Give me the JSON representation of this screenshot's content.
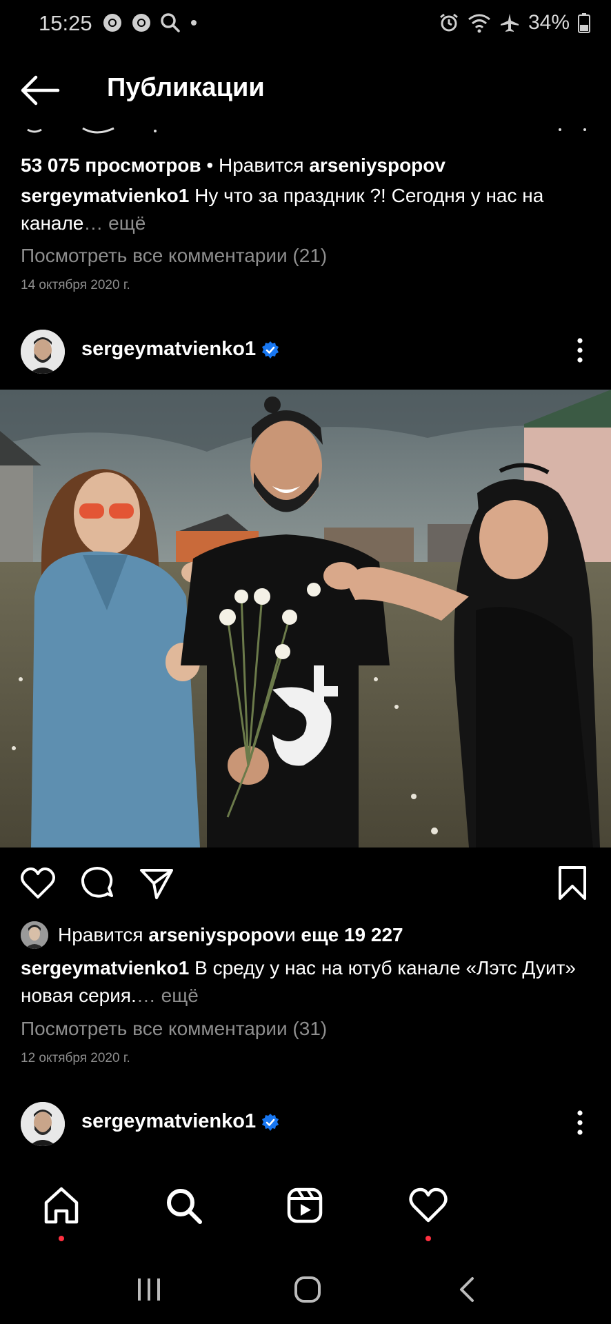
{
  "status_bar": {
    "time": "15:25",
    "battery": "34%",
    "left_icons": [
      "chrome-icon",
      "chrome-icon",
      "search-icon",
      "dot-icon"
    ],
    "right_icons": [
      "alarm-icon",
      "wifi-icon",
      "airplane-icon",
      "battery-icon"
    ]
  },
  "header": {
    "title": "Публикации",
    "back_icon": "arrow-left-icon"
  },
  "post_prev": {
    "views": "53 075 просмотров",
    "likes_sep": " • Нравится ",
    "liker": "arseniyspopov",
    "author": "sergeymatvienko1",
    "caption": " Ну что за праздник ?! Сегодня у нас на канале",
    "more": "… ещё",
    "comments": "Посмотреть все комментарии (21)",
    "date": "14 октября 2020 г."
  },
  "post_main": {
    "author": "sergeymatvienko1",
    "likes_prefix": "Нравится ",
    "liker": "arseniyspopov",
    "likes_mid": " и ",
    "likes_more": "еще 19 227",
    "caption": " В среду у нас на ютуб канале «Лэтс Дуит» новая серия.",
    "more": "… ещё",
    "comments": "Посмотреть все комментарии (31)",
    "date": "12 октября 2020 г."
  },
  "post_next": {
    "author": "sergeymatvienko1"
  },
  "actions": [
    "heart-icon",
    "comment-icon",
    "share-icon",
    "bookmark-icon"
  ],
  "bottom_nav": [
    "home-icon",
    "search-icon",
    "reels-icon",
    "activity-heart-icon"
  ],
  "system_nav": [
    "recents-icon",
    "home-circle-icon",
    "back-chevron-icon"
  ],
  "colors": {
    "background": "#000000",
    "muted_text": "#8e8e8e",
    "verified": "#1877f2",
    "notification_dot": "#ff3040"
  }
}
